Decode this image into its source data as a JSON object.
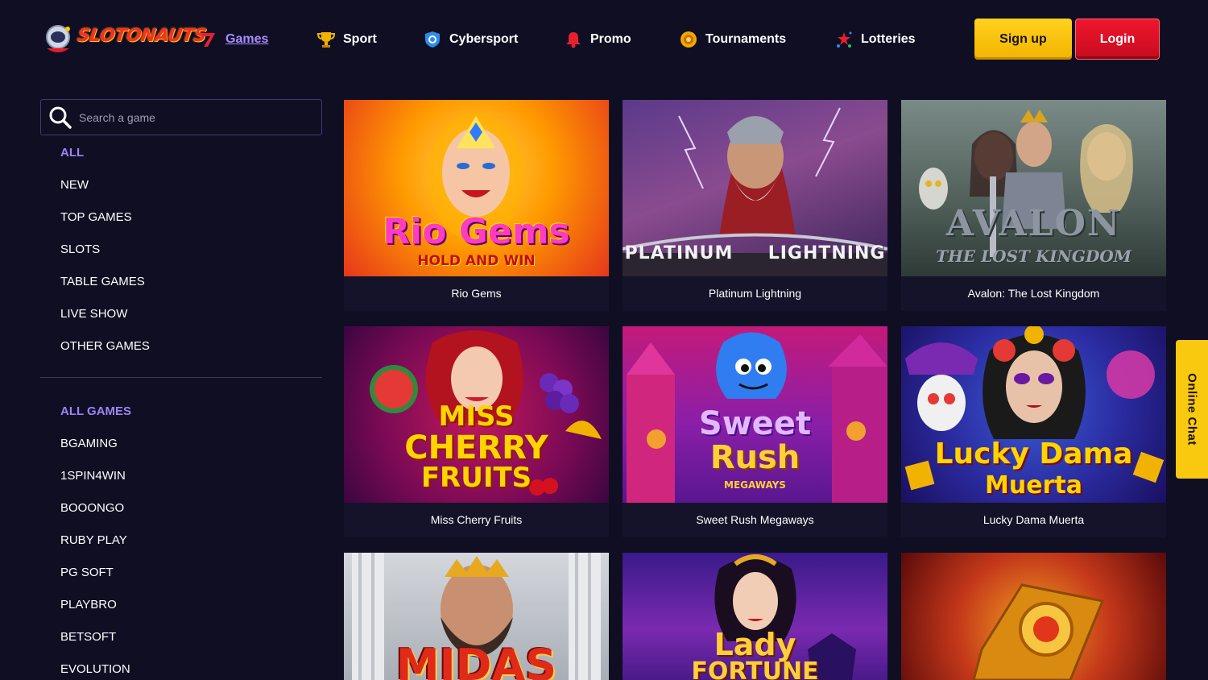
{
  "header": {
    "logo_text": "SLOTONAUTS",
    "nav": [
      {
        "label": "Games",
        "icon": "seven-icon"
      },
      {
        "label": "Sport",
        "icon": "trophy-icon"
      },
      {
        "label": "Cybersport",
        "icon": "shield-icon"
      },
      {
        "label": "Promo",
        "icon": "bell-icon"
      },
      {
        "label": "Tournaments",
        "icon": "medal-icon"
      },
      {
        "label": "Lotteries",
        "icon": "confetti-icon"
      }
    ],
    "signup_label": "Sign up",
    "login_label": "Login"
  },
  "sidebar": {
    "search_placeholder": "Search a game",
    "categories": [
      "ALL",
      "NEW",
      "TOP GAMES",
      "SLOTS",
      "TABLE GAMES",
      "LIVE SHOW",
      "OTHER GAMES"
    ],
    "providers": [
      "ALL GAMES",
      "BGAMING",
      "1SPIN4WIN",
      "BOOONGO",
      "RUBY PLAY",
      "PG SOFT",
      "PLAYBRO",
      "BETSOFT",
      "EVOLUTION"
    ]
  },
  "games": [
    {
      "title": "Rio Gems",
      "art_main": "Rio Gems",
      "art_sub": "HOLD AND WIN"
    },
    {
      "title": "Platinum Lightning",
      "art_main": "PLATINUM",
      "art_sub": "LIGHTNING"
    },
    {
      "title": "Avalon: The Lost Kingdom",
      "art_main": "AVALON",
      "art_sub": "THE LOST KINGDOM"
    },
    {
      "title": "Miss Cherry Fruits",
      "art_main": "CHERRY",
      "art_sub": "FRUITS",
      "art_top": "MISS"
    },
    {
      "title": "Sweet Rush Megaways",
      "art_main": "Rush",
      "art_sub": "MEGAWAYS",
      "art_top": "Sweet"
    },
    {
      "title": "Lucky Dama Muerta",
      "art_main": "Lucky Dama",
      "art_sub": "Muerta"
    },
    {
      "title": "",
      "art_main": "MIDAS"
    },
    {
      "title": "",
      "art_main": "FORTUNE",
      "art_top": "Lady"
    },
    {
      "title": "",
      "art_main": ""
    }
  ],
  "chat_label": "Online Chat",
  "colors": {
    "background": "#100e23",
    "accent_purple": "#9b85f5",
    "signup_yellow": "#f9c90f",
    "login_red": "#e0112a"
  }
}
